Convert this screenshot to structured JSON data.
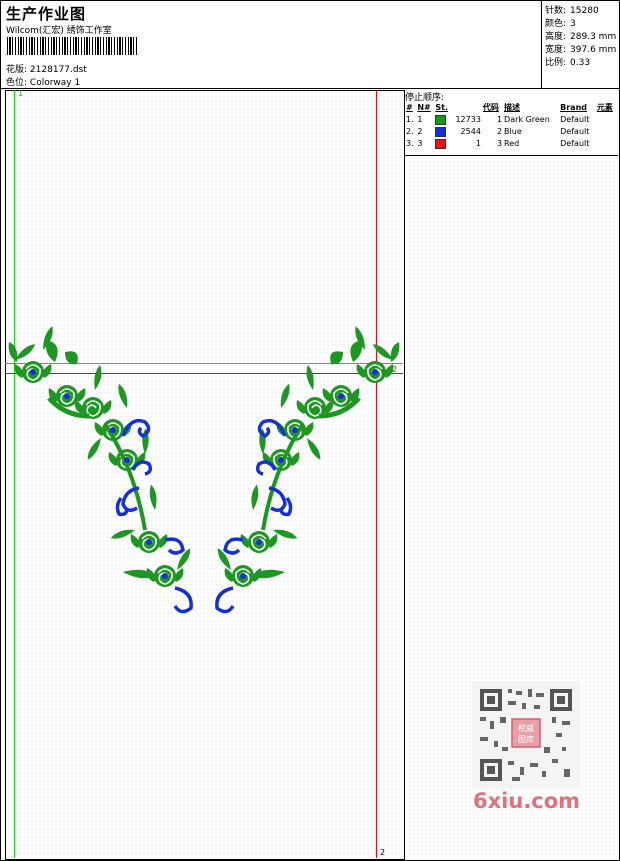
{
  "header": {
    "title": "生产作业图",
    "subtitle": "Wilcom(汇宏) 绣饰工作室",
    "design_file_label": "花版:",
    "design_file": "2128177.dst",
    "colorway_label": "色位:",
    "colorway": "Colorway 1"
  },
  "stats": [
    {
      "label": "针数:",
      "value": "15280"
    },
    {
      "label": "颜色:",
      "value": "3"
    },
    {
      "label": "高度:",
      "value": "289.3 mm"
    },
    {
      "label": "宽度:",
      "value": "397.6 mm"
    },
    {
      "label": "比例:",
      "value": "0.33"
    }
  ],
  "stops": {
    "title": "停止顺序:",
    "columns": [
      "#",
      "N#",
      "St.",
      "代码",
      "描述",
      "Brand",
      "元素"
    ],
    "rows": [
      {
        "idx": "1.",
        "n": "1",
        "stitches": "12733",
        "code": "1",
        "desc": "Dark Green",
        "brand": "Default",
        "color": "#1e9622"
      },
      {
        "idx": "2.",
        "n": "2",
        "stitches": "2544",
        "code": "2",
        "desc": "Blue",
        "brand": "Default",
        "color": "#1530d8"
      },
      {
        "idx": "3.",
        "n": "3",
        "stitches": "1",
        "code": "3",
        "desc": "Red",
        "brand": "Default",
        "color": "#e8141c"
      }
    ]
  },
  "guides": {
    "green_label": "1",
    "red_label": "2",
    "red_label_mid": "2"
  },
  "colors": {
    "thread_green": "#1e9622",
    "thread_blue": "#1530d8",
    "guide_red": "#e01010",
    "guide_green": "#22cc22"
  },
  "watermark": {
    "text": "6xiu.com",
    "qr_center": "权威图库"
  }
}
